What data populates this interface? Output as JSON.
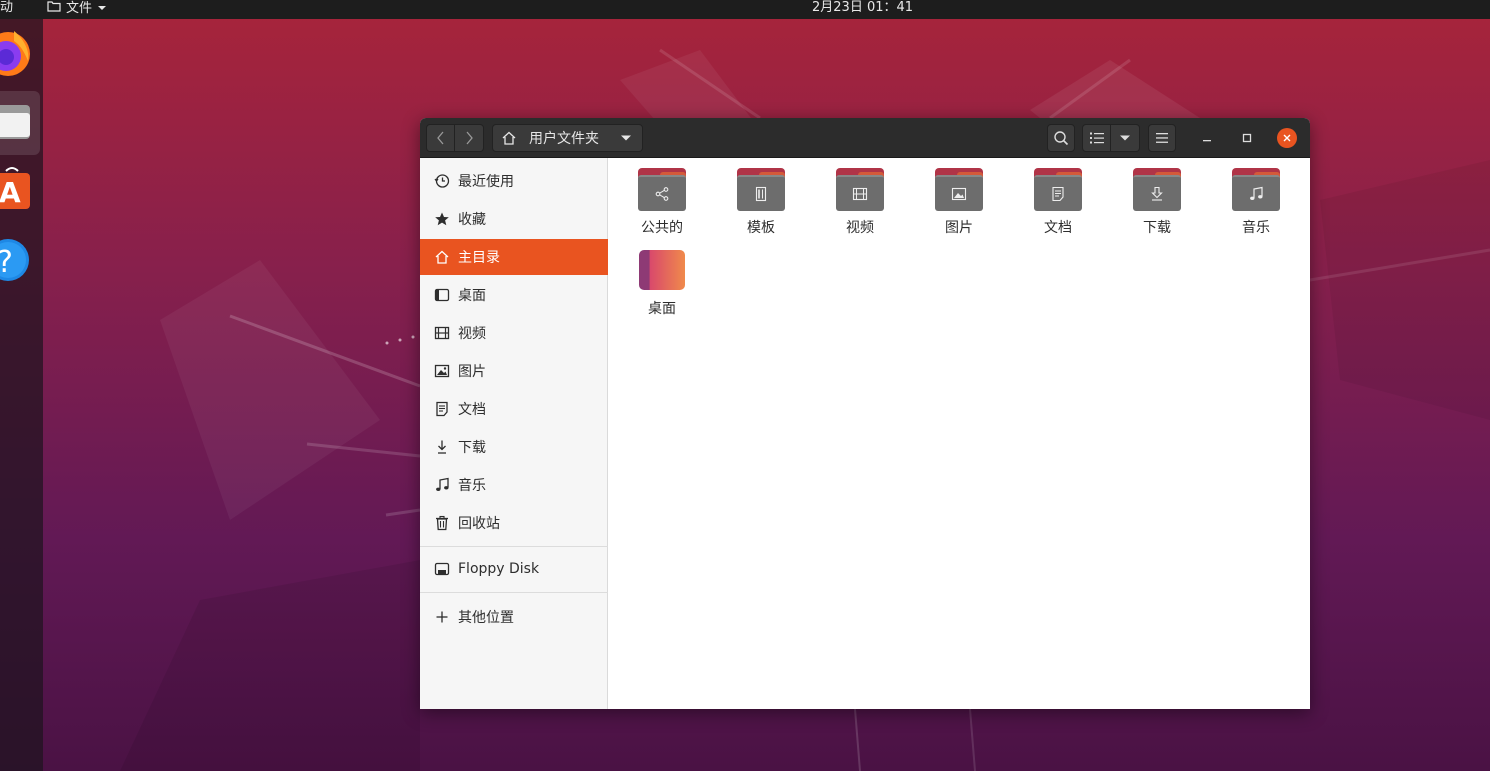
{
  "topbar": {
    "activities": "动",
    "app_menu": "文件",
    "clock": "2月23日 01：41"
  },
  "dock": {
    "items": [
      {
        "name": "firefox",
        "icon": "firefox-icon"
      },
      {
        "name": "files",
        "icon": "files-icon",
        "active": true
      },
      {
        "name": "software",
        "icon": "software-store-icon"
      },
      {
        "name": "help",
        "icon": "help-icon"
      }
    ]
  },
  "window": {
    "path_label": "用户文件夹",
    "sidebar": {
      "items": [
        {
          "label": "最近使用",
          "icon": "clock-icon"
        },
        {
          "label": "收藏",
          "icon": "star-icon"
        },
        {
          "label": "主目录",
          "icon": "home-icon",
          "selected": true
        },
        {
          "label": "桌面",
          "icon": "desktop-icon"
        },
        {
          "label": "视频",
          "icon": "video-icon"
        },
        {
          "label": "图片",
          "icon": "image-icon"
        },
        {
          "label": "文档",
          "icon": "document-icon"
        },
        {
          "label": "下载",
          "icon": "download-icon"
        },
        {
          "label": "音乐",
          "icon": "music-icon"
        },
        {
          "label": "回收站",
          "icon": "trash-icon"
        }
      ],
      "devices": [
        {
          "label": "Floppy Disk",
          "icon": "floppy-icon"
        }
      ],
      "other": {
        "label": "其他位置",
        "icon": "plus-icon"
      }
    },
    "files": [
      {
        "label": "公共的",
        "icon": "share-icon"
      },
      {
        "label": "模板",
        "icon": "template-icon"
      },
      {
        "label": "视频",
        "icon": "video-icon"
      },
      {
        "label": "图片",
        "icon": "image-icon"
      },
      {
        "label": "文档",
        "icon": "document-icon"
      },
      {
        "label": "下载",
        "icon": "download-icon"
      },
      {
        "label": "音乐",
        "icon": "music-icon"
      },
      {
        "label": "桌面",
        "icon": "desktop-folder-icon"
      }
    ]
  },
  "colors": {
    "accent": "#e95420",
    "headerbar": "#2c2c2c",
    "sidebar": "#f6f6f6"
  }
}
